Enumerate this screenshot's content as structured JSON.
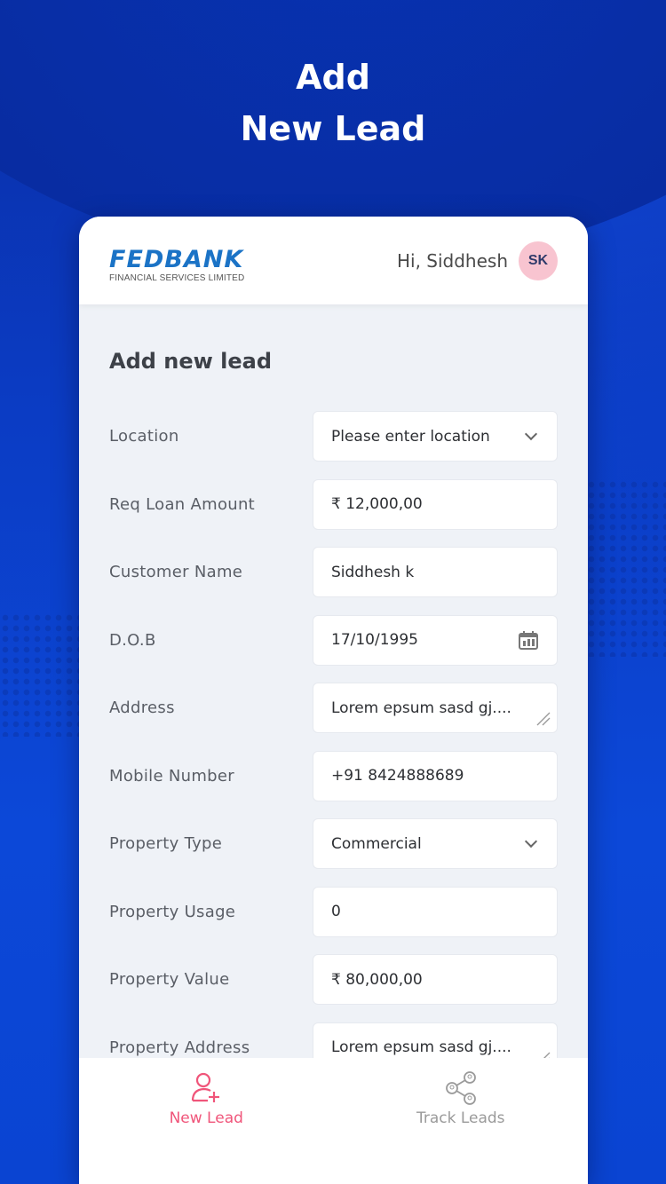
{
  "hero": {
    "line1": "Add",
    "line2": "New Lead"
  },
  "header": {
    "brand": "FEDBANK",
    "brand_sub": "FINANCIAL SERVICES LIMITED",
    "greeting": "Hi, Siddhesh",
    "avatar_initials": "SK"
  },
  "form": {
    "title": "Add new lead",
    "fields": [
      {
        "label": "Location",
        "value": "Please enter location",
        "type": "select"
      },
      {
        "label": "Req Loan Amount",
        "value": "₹ 12,000,00",
        "type": "text"
      },
      {
        "label": "Customer Name",
        "value": "Siddhesh k",
        "type": "text"
      },
      {
        "label": "D.O.B",
        "value": "17/10/1995",
        "type": "date"
      },
      {
        "label": "Address",
        "value": "Lorem epsum sasd gj....",
        "type": "textarea"
      },
      {
        "label": "Mobile Number",
        "value": "+91 8424888689",
        "type": "text"
      },
      {
        "label": "Property Type",
        "value": "Commercial",
        "type": "select"
      },
      {
        "label": "Property Usage",
        "value": "0",
        "type": "text"
      },
      {
        "label": "Property Value",
        "value": "₹ 80,000,00",
        "type": "text"
      },
      {
        "label": "Property Address",
        "value": "Lorem epsum sasd gj....",
        "type": "textarea"
      }
    ]
  },
  "bottom_nav": {
    "items": [
      {
        "label": "New Lead",
        "icon": "user-add-icon",
        "active": true
      },
      {
        "label": "Track Leads",
        "icon": "share-network-icon",
        "active": false
      }
    ]
  },
  "colors": {
    "brand_blue": "#1b73c6",
    "accent_pink": "#f0557a",
    "background_blue": "#0b3cc4"
  }
}
